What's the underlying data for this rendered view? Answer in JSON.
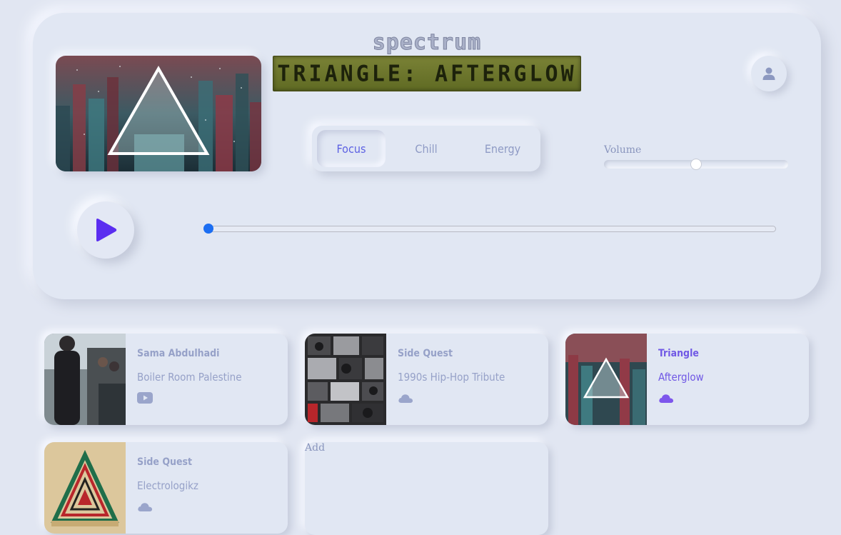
{
  "app": {
    "logo_text": "spectrum",
    "lcd_text": "TRIANGLE: AFTERGLOW"
  },
  "modes": [
    {
      "label": "Focus",
      "active": true
    },
    {
      "label": "Chill",
      "active": false
    },
    {
      "label": "Energy",
      "active": false
    }
  ],
  "volume": {
    "label": "Volume",
    "level": 0.5
  },
  "playback": {
    "progress": 0.0
  },
  "tracks": [
    {
      "artist": "Sama Abdulhadi",
      "title": "Boiler Room Palestine",
      "source_icon": "youtube-icon",
      "active": false
    },
    {
      "artist": "Side Quest",
      "title": "1990s Hip-Hop Tribute",
      "source_icon": "cloud-icon",
      "active": false
    },
    {
      "artist": "Triangle",
      "title": "Afterglow",
      "source_icon": "cloud-icon",
      "active": true
    },
    {
      "artist": "Side Quest",
      "title": "Electrologikz",
      "source_icon": "cloud-icon",
      "active": false
    }
  ],
  "add_card": {
    "label": "Add"
  },
  "colors": {
    "background": "#e1e6f2",
    "accent": "#5e62e3",
    "muted_text": "#96a1c8",
    "active_text": "#7058e5",
    "play_icon": "#5a2df0",
    "progress_knob": "#1c6ef2"
  }
}
